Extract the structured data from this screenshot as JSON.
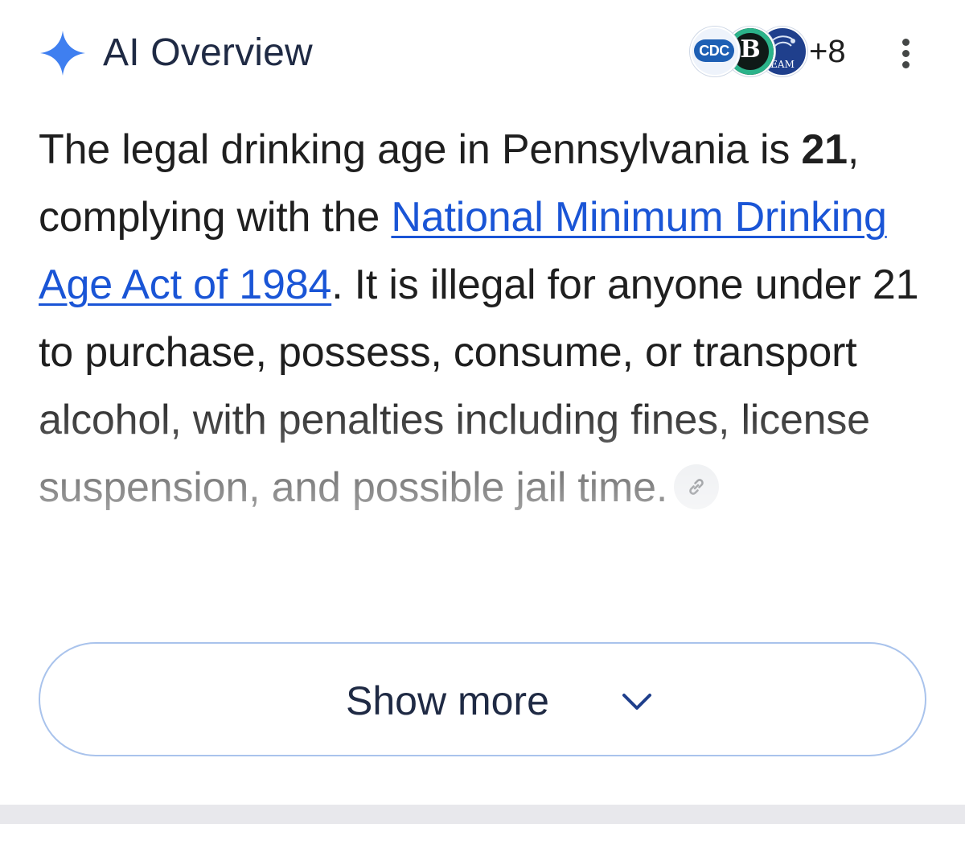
{
  "header": {
    "title": "AI Overview",
    "sources": {
      "items": [
        {
          "label": "CDC",
          "color": "#1d5fb4"
        },
        {
          "label": "B",
          "color": "#2bb38a"
        },
        {
          "label": "EAM",
          "color": "#1f3f8c"
        }
      ],
      "more_count": "+8"
    },
    "sparkle_color": "#3f7ff0"
  },
  "answer": {
    "text_1": "The legal drinking age in Pennsylvania is ",
    "bold_age": "21",
    "text_2": ", complying with the ",
    "link_text": "National Minimum Drinking Age Act of 1984",
    "text_3": ". It is illegal for anyone under 21 to purchase, possess, consume, or transport alcohol, with penalties including fines, license suspension, and possible jail time.",
    "link_color": "#1a55d6"
  },
  "show_more": {
    "label": "Show more"
  },
  "icons": {
    "sparkle": "sparkle-icon",
    "kebab": "more-vert-icon",
    "citation": "link-icon",
    "chevron": "chevron-down-icon"
  }
}
